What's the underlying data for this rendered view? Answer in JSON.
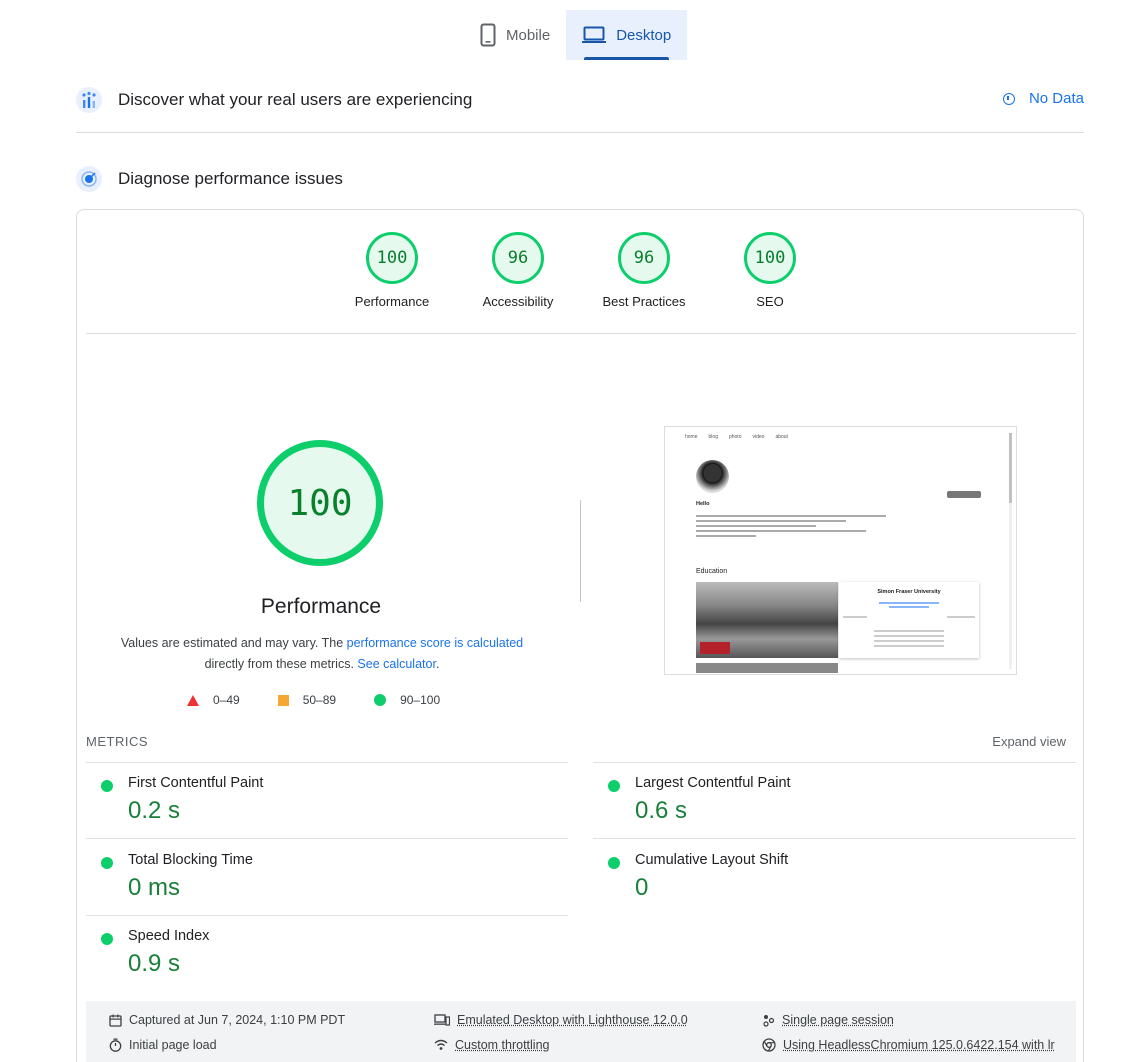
{
  "tabs": [
    {
      "label": "Mobile",
      "icon": "phone-icon",
      "active": false
    },
    {
      "label": "Desktop",
      "icon": "laptop-icon",
      "active": true
    }
  ],
  "field_section": {
    "title": "Discover what your real users are experiencing",
    "status": "No Data"
  },
  "lab_section": {
    "title": "Diagnose performance issues"
  },
  "categories": [
    {
      "score": "100",
      "label": "Performance"
    },
    {
      "score": "96",
      "label": "Accessibility"
    },
    {
      "score": "96",
      "label": "Best Practices"
    },
    {
      "score": "100",
      "label": "SEO"
    }
  ],
  "performance": {
    "score": "100",
    "title": "Performance",
    "desc_prefix": "Values are estimated and may vary. The ",
    "desc_link1": "performance score is calculated",
    "desc_middle": "directly from these metrics. ",
    "desc_link2": "See calculator",
    "desc_suffix": "."
  },
  "legend": [
    {
      "range": "0–49",
      "color": "#e33"
    },
    {
      "range": "50–89",
      "color": "#f4a732"
    },
    {
      "range": "90–100",
      "color": "#0cce6b"
    }
  ],
  "screenshot": {
    "nav": [
      "home",
      "blog",
      "photo",
      "video",
      "about"
    ],
    "hello": "Hello",
    "education": "Education",
    "university": "Simon Fraser University"
  },
  "metrics": {
    "heading": "METRICS",
    "expand": "Expand view",
    "items": [
      {
        "name": "First Contentful Paint",
        "value": "0.2 s"
      },
      {
        "name": "Largest Contentful Paint",
        "value": "0.6 s"
      },
      {
        "name": "Total Blocking Time",
        "value": "0 ms"
      },
      {
        "name": "Cumulative Layout Shift",
        "value": "0"
      },
      {
        "name": "Speed Index",
        "value": "0.9 s"
      }
    ]
  },
  "footer": {
    "captured": "Captured at Jun 7, 2024, 1:10 PM PDT",
    "initial_load": "Initial page load",
    "emulated": "Emulated Desktop with Lighthouse 12.0.0",
    "throttling": "Custom throttling",
    "session": "Single page session",
    "browser": "Using HeadlessChromium 125.0.6422.154 with lr"
  },
  "colors": {
    "pass": "#0cce6b",
    "pass_text": "#188038",
    "link": "#1a73e8",
    "active_tab": "#1a56a8"
  }
}
